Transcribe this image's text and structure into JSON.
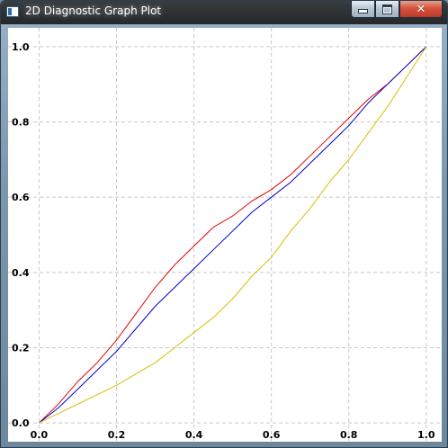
{
  "window": {
    "title": "2D Diagnostic Graph Plot",
    "controls": {
      "minimize": "minimize",
      "maximize": "maximize",
      "close": "close"
    }
  },
  "chart_data": {
    "type": "line",
    "title": "",
    "xlabel": "",
    "ylabel": "",
    "xlim": [
      -0.08,
      1.04
    ],
    "ylim": [
      -0.05,
      1.05
    ],
    "x_ticks": [
      "0.0",
      "0.2",
      "0.4",
      "0.6",
      "0.8",
      "1.0"
    ],
    "y_ticks": [
      "0.0",
      "0.2",
      "0.4",
      "0.6",
      "0.8",
      "1.0"
    ],
    "grid": true,
    "series": [
      {
        "color": "#e00000",
        "x": [
          0.0,
          0.05,
          0.1,
          0.15,
          0.2,
          0.25,
          0.3,
          0.35,
          0.4,
          0.45,
          0.5,
          0.55,
          0.6,
          0.65,
          0.7,
          0.75,
          0.8,
          0.85,
          0.9,
          0.95,
          1.0
        ],
        "y": [
          0.0,
          0.05,
          0.11,
          0.16,
          0.22,
          0.29,
          0.36,
          0.42,
          0.47,
          0.52,
          0.55,
          0.59,
          0.62,
          0.66,
          0.71,
          0.76,
          0.81,
          0.86,
          0.9,
          0.95,
          1.0
        ]
      },
      {
        "color": "#0000cc",
        "x": [
          0.0,
          0.05,
          0.1,
          0.15,
          0.2,
          0.25,
          0.3,
          0.35,
          0.4,
          0.45,
          0.5,
          0.55,
          0.6,
          0.65,
          0.7,
          0.75,
          0.8,
          0.85,
          0.9,
          0.95,
          1.0
        ],
        "y": [
          0.0,
          0.04,
          0.09,
          0.14,
          0.19,
          0.25,
          0.31,
          0.36,
          0.41,
          0.46,
          0.51,
          0.56,
          0.6,
          0.64,
          0.69,
          0.74,
          0.79,
          0.85,
          0.9,
          0.95,
          1.0
        ]
      },
      {
        "color": "#d4c000",
        "x": [
          0.0,
          0.05,
          0.1,
          0.15,
          0.2,
          0.25,
          0.3,
          0.35,
          0.4,
          0.45,
          0.5,
          0.55,
          0.6,
          0.65,
          0.7,
          0.75,
          0.8,
          0.85,
          0.9,
          0.95,
          1.0
        ],
        "y": [
          0.0,
          0.025,
          0.05,
          0.075,
          0.1,
          0.13,
          0.16,
          0.2,
          0.24,
          0.28,
          0.33,
          0.39,
          0.44,
          0.51,
          0.57,
          0.64,
          0.7,
          0.77,
          0.84,
          0.92,
          1.0
        ]
      }
    ]
  }
}
